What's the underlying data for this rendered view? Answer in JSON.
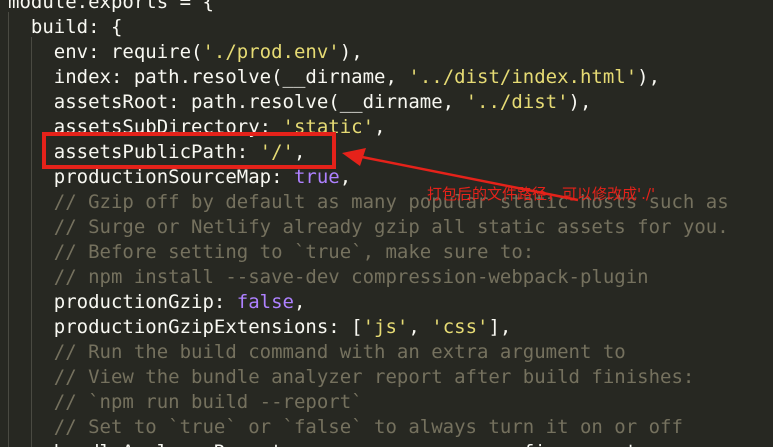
{
  "editor": {
    "lines": [
      {
        "segments": [
          {
            "t": "module.exports = {",
            "c": "pl"
          }
        ]
      },
      {
        "segments": [
          {
            "t": "  build: {",
            "c": "pl"
          }
        ]
      },
      {
        "segments": [
          {
            "t": "    env: require(",
            "c": "pl"
          },
          {
            "t": "'./prod.env'",
            "c": "str"
          },
          {
            "t": "),",
            "c": "pl"
          }
        ]
      },
      {
        "segments": [
          {
            "t": "    index: path.resolve(__dirname, ",
            "c": "pl"
          },
          {
            "t": "'../dist/index.html'",
            "c": "str"
          },
          {
            "t": "),",
            "c": "pl"
          }
        ]
      },
      {
        "segments": [
          {
            "t": "    assetsRoot: path.resolve(__dirname, ",
            "c": "pl"
          },
          {
            "t": "'../dist'",
            "c": "str"
          },
          {
            "t": "),",
            "c": "pl"
          }
        ]
      },
      {
        "segments": [
          {
            "t": "    assetsSubDirectory: ",
            "c": "pl"
          },
          {
            "t": "'static'",
            "c": "str"
          },
          {
            "t": ",",
            "c": "pl"
          }
        ]
      },
      {
        "segments": [
          {
            "t": "    assetsPublicPath: ",
            "c": "pl"
          },
          {
            "t": "'/'",
            "c": "str"
          },
          {
            "t": ",",
            "c": "pl"
          }
        ]
      },
      {
        "segments": [
          {
            "t": "    productionSourceMap: ",
            "c": "pl"
          },
          {
            "t": "true",
            "c": "kw"
          },
          {
            "t": ",",
            "c": "pl"
          }
        ]
      },
      {
        "segments": [
          {
            "t": "    // Gzip off by default as many popular static hosts such as",
            "c": "cm"
          }
        ]
      },
      {
        "segments": [
          {
            "t": "    // Surge or Netlify already gzip all static assets for you.",
            "c": "cm"
          }
        ]
      },
      {
        "segments": [
          {
            "t": "    // Before setting to `true`, make sure to:",
            "c": "cm"
          }
        ]
      },
      {
        "segments": [
          {
            "t": "    // npm install --save-dev compression-webpack-plugin",
            "c": "cm"
          }
        ]
      },
      {
        "segments": [
          {
            "t": "    productionGzip: ",
            "c": "pl"
          },
          {
            "t": "false",
            "c": "kw"
          },
          {
            "t": ",",
            "c": "pl"
          }
        ]
      },
      {
        "segments": [
          {
            "t": "    productionGzipExtensions: [",
            "c": "pl"
          },
          {
            "t": "'js'",
            "c": "str"
          },
          {
            "t": ", ",
            "c": "pl"
          },
          {
            "t": "'css'",
            "c": "str"
          },
          {
            "t": "],",
            "c": "pl"
          }
        ]
      },
      {
        "segments": [
          {
            "t": "    // Run the build command with an extra argument to",
            "c": "cm"
          }
        ]
      },
      {
        "segments": [
          {
            "t": "    // View the bundle analyzer report after build finishes:",
            "c": "cm"
          }
        ]
      },
      {
        "segments": [
          {
            "t": "    // `npm run build --report`",
            "c": "cm"
          }
        ]
      },
      {
        "segments": [
          {
            "t": "    // Set to `true` or `false` to always turn it on or off",
            "c": "cm"
          }
        ]
      },
      {
        "segments": [
          {
            "t": "    bundleAnalyzerReport: process.env.npm_config_report",
            "c": "pl"
          }
        ]
      }
    ]
  },
  "annotation": {
    "text": "打包后的文件路径，可以修改成'./'",
    "color": "#e5221a"
  },
  "colors": {
    "background": "#272822",
    "plain": "#f8f8f2",
    "string": "#e6db74",
    "keyword": "#ae81ff",
    "comment": "#75715e",
    "annotation_red": "#e5221a"
  }
}
